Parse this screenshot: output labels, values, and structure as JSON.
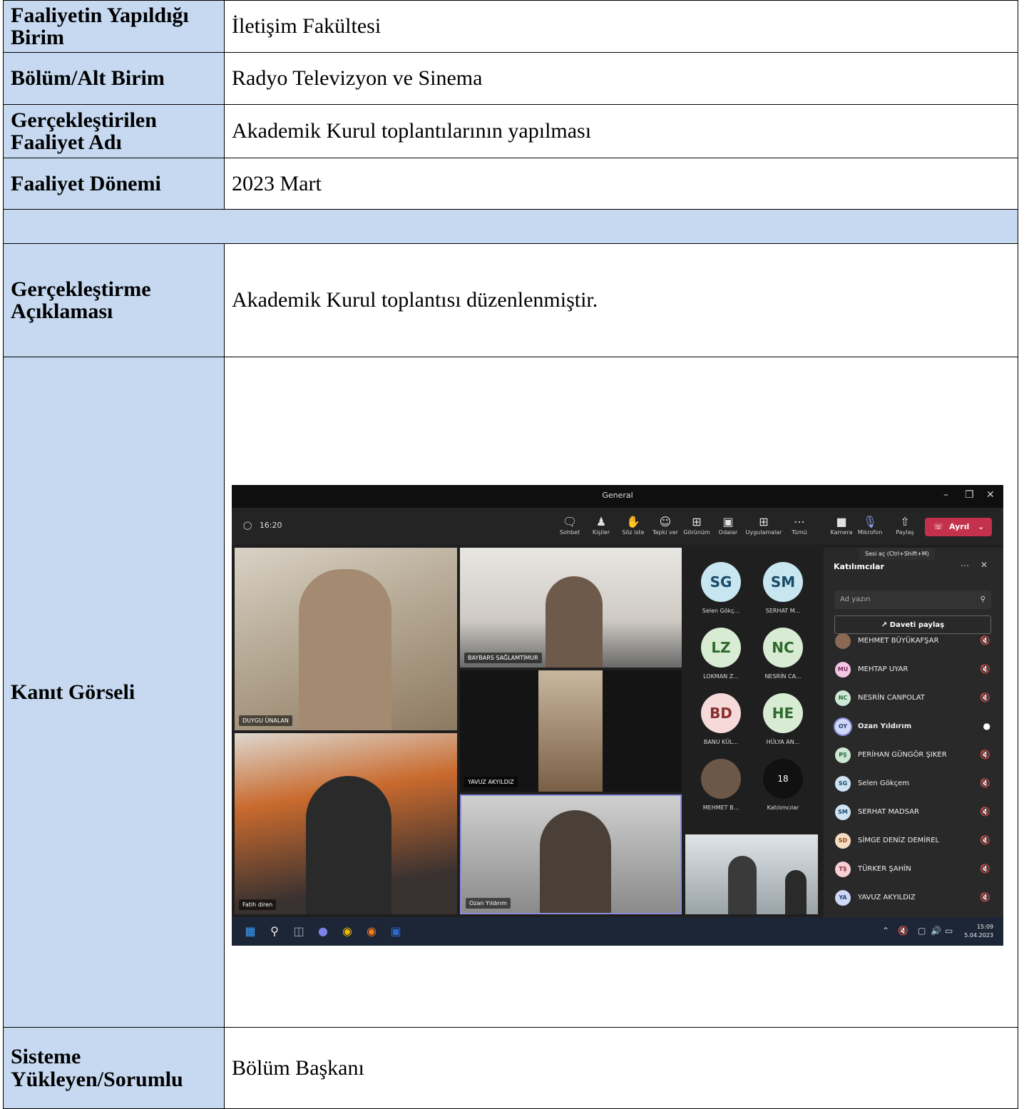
{
  "form": {
    "rows": [
      {
        "label": "Faaliyetin Yapıldığı Birim",
        "value": "İletişim Fakültesi"
      },
      {
        "label": "Bölüm/Alt Birim",
        "value": "Radyo Televizyon ve Sinema"
      },
      {
        "label": "Gerçekleştirilen Faaliyet Adı",
        "value": "Akademik Kurul toplantılarının yapılması"
      },
      {
        "label": "Faaliyet Dönemi",
        "value": "2023 Mart"
      },
      {
        "label": "Gerçekleştirme Açıklaması",
        "value": "Akademik Kurul toplantısı düzenlenmiştir."
      },
      {
        "label": "Kanıt Görseli"
      },
      {
        "label": "Sisteme Yükleyen/Sorumlu",
        "value": "Bölüm Başkanı"
      }
    ]
  },
  "teams": {
    "window_title": "General",
    "meeting_timer": "16:20",
    "toolbar": {
      "chat": "Sohbet",
      "people": "Kişiler",
      "raise_hand": "Söz iste",
      "react": "Tepki ver",
      "view": "Görünüm",
      "rooms": "Odalar",
      "apps": "Uygulamalar",
      "more": "Tümü",
      "camera": "Kamera",
      "mic": "Mikrofon",
      "share": "Paylaş",
      "leave": "Ayrıl"
    },
    "tooltip": "Sesi aç (Ctrl+Shift+M)",
    "video_tiles": [
      {
        "name": "DUYGU ÜNALAN"
      },
      {
        "name": "BAYBARS SAĞLAMTİMUR"
      },
      {
        "name": "YAVUZ AKYILDIZ"
      },
      {
        "name": "Fatih diren"
      },
      {
        "name": "Ozan Yıldırım"
      }
    ],
    "avatars": [
      {
        "initials": "SG",
        "name": "Selen Gökç...",
        "color": "#c8e6ef"
      },
      {
        "initials": "SM",
        "name": "SERHAT M...",
        "color": "#c8e6ef"
      },
      {
        "initials": "LZ",
        "name": "LOKMAN Z...",
        "color": "#d8ecd4"
      },
      {
        "initials": "NC",
        "name": "NESRİN CA...",
        "color": "#d8ecd4"
      },
      {
        "initials": "BD",
        "name": "BANU KÜL...",
        "color": "#f6dada"
      },
      {
        "initials": "HE",
        "name": "HÜLYA AN...",
        "color": "#d8ecd4"
      },
      {
        "initials": "",
        "name": "MEHMET B...",
        "color": "#6d5747"
      },
      {
        "initials": "18",
        "name": "Katılımcılar",
        "color": "#111111"
      }
    ],
    "panel": {
      "title": "Katılımcılar",
      "search_placeholder": "Ad yazın",
      "invite": "Daveti paylaş",
      "participants": [
        {
          "initials": "",
          "name": "MEHMET BÜYÜKAFŞAR",
          "color": "#8a6a55"
        },
        {
          "initials": "MU",
          "name": "MEHTAP UYAR",
          "color": "#f3c6e3"
        },
        {
          "initials": "NC",
          "name": "NESRİN CANPOLAT",
          "color": "#cde9d5"
        },
        {
          "initials": "OY",
          "name": "Ozan Yıldırım",
          "color": "#cfd9f5"
        },
        {
          "initials": "PŞ",
          "name": "PERİHAN GÜNGÖR ŞIKER",
          "color": "#cde9d5"
        },
        {
          "initials": "SG",
          "name": "Selen Gökçem",
          "color": "#cfe3f3"
        },
        {
          "initials": "SM",
          "name": "SERHAT MADSAR",
          "color": "#cfe3f3"
        },
        {
          "initials": "SD",
          "name": "SİMGE DENİZ DEMİREL",
          "color": "#f7dcc4"
        },
        {
          "initials": "TŞ",
          "name": "TÜRKER ŞAHİN",
          "color": "#f6d0d4"
        },
        {
          "initials": "YA",
          "name": "YAVUZ AKYILDIZ",
          "color": "#cfd9f5"
        }
      ]
    },
    "taskbar": {
      "time": "15:09",
      "date": "5.04.2023"
    }
  }
}
